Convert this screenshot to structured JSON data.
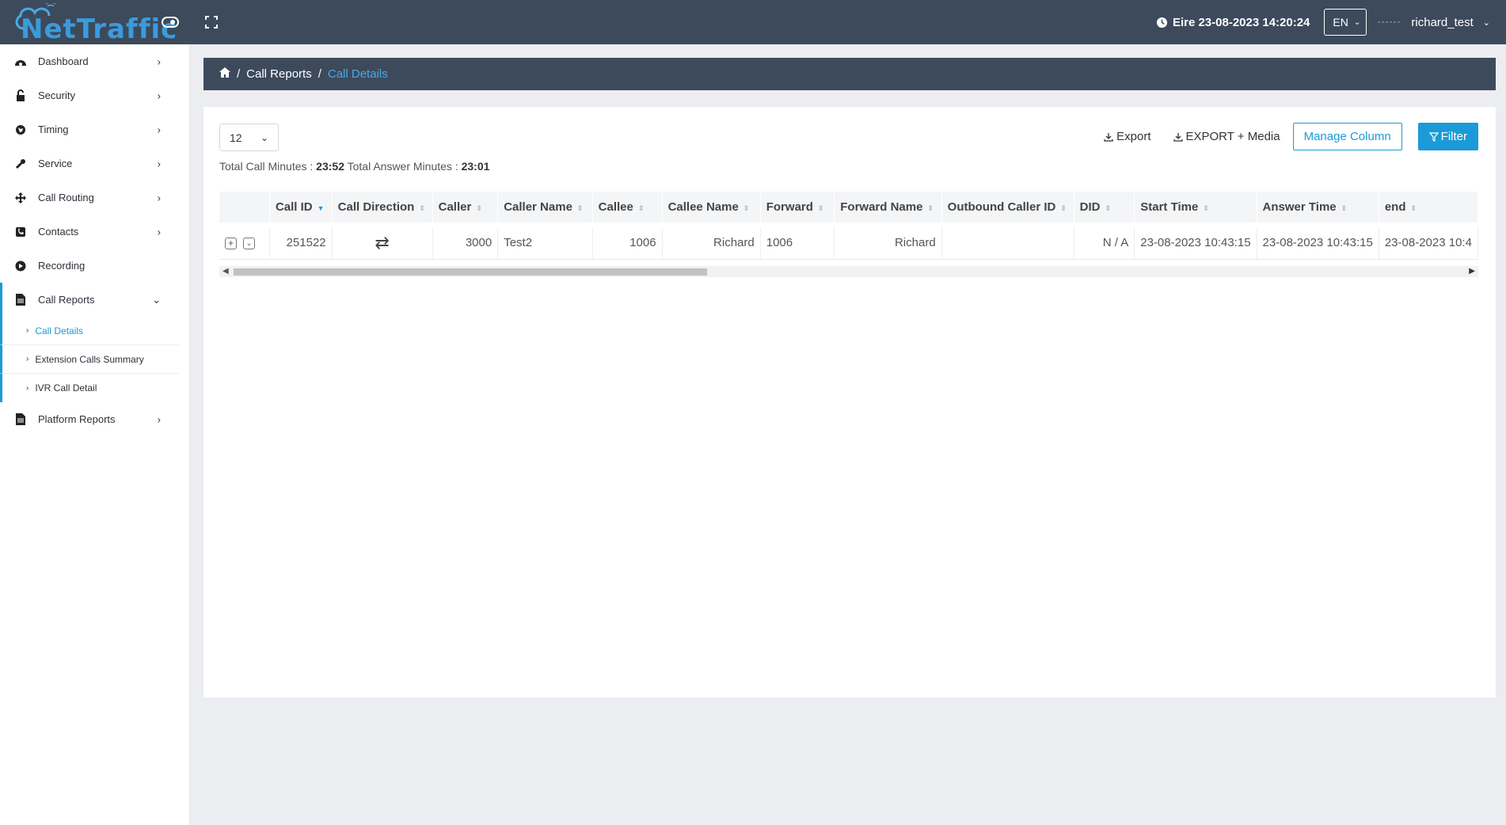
{
  "brand": {
    "logo_text": "NetTraffic"
  },
  "header": {
    "timezone_time": "Eire 23-08-2023 14:20:24",
    "language": "EN",
    "username": "richard_test"
  },
  "sidebar": {
    "items": [
      {
        "label": "Dashboard",
        "icon": "dashboard-icon"
      },
      {
        "label": "Security",
        "icon": "lock-icon"
      },
      {
        "label": "Timing",
        "icon": "globe-icon"
      },
      {
        "label": "Service",
        "icon": "wrench-icon"
      },
      {
        "label": "Call Routing",
        "icon": "arrows-icon"
      },
      {
        "label": "Contacts",
        "icon": "phone-book-icon"
      },
      {
        "label": "Recording",
        "icon": "record-icon"
      },
      {
        "label": "Call Reports",
        "icon": "document-icon"
      },
      {
        "label": "Platform Reports",
        "icon": "document-icon"
      }
    ],
    "subitems": [
      {
        "label": "Call Details"
      },
      {
        "label": "Extension Calls Summary"
      },
      {
        "label": "IVR Call Detail"
      }
    ]
  },
  "breadcrumb": {
    "parent": "Call Reports",
    "separator": "/",
    "current": "Call Details"
  },
  "toolbar": {
    "page_size": "12",
    "export_label": "Export",
    "export_media_label": "EXPORT + Media",
    "manage_column_label": "Manage Column",
    "filter_label": "Filter"
  },
  "totals": {
    "call_minutes_label": "Total Call Minutes :",
    "call_minutes_value": "23:52",
    "answer_minutes_label": "Total Answer Minutes :",
    "answer_minutes_value": "23:01"
  },
  "table": {
    "columns": [
      "Call ID",
      "Call Direction",
      "Caller",
      "Caller Name",
      "Callee",
      "Callee Name",
      "Forward",
      "Forward Name",
      "Outbound Caller ID",
      "DID",
      "Start Time",
      "Answer Time",
      "end"
    ],
    "rows": [
      {
        "call_id": "251522",
        "direction": "⇄",
        "caller": "3000",
        "caller_name": "Test2",
        "callee": "1006",
        "callee_name": "Richard",
        "forward": "1006",
        "forward_name": "Richard",
        "outbound_caller_id": "",
        "did": "N / A",
        "start_time": "23-08-2023 10:43:15",
        "answer_time": "23-08-2023 10:43:15",
        "end": "23-08-2023 10:4"
      }
    ]
  },
  "colors": {
    "accent": "#1a9bd7",
    "header_bg": "#3c4a5c"
  }
}
